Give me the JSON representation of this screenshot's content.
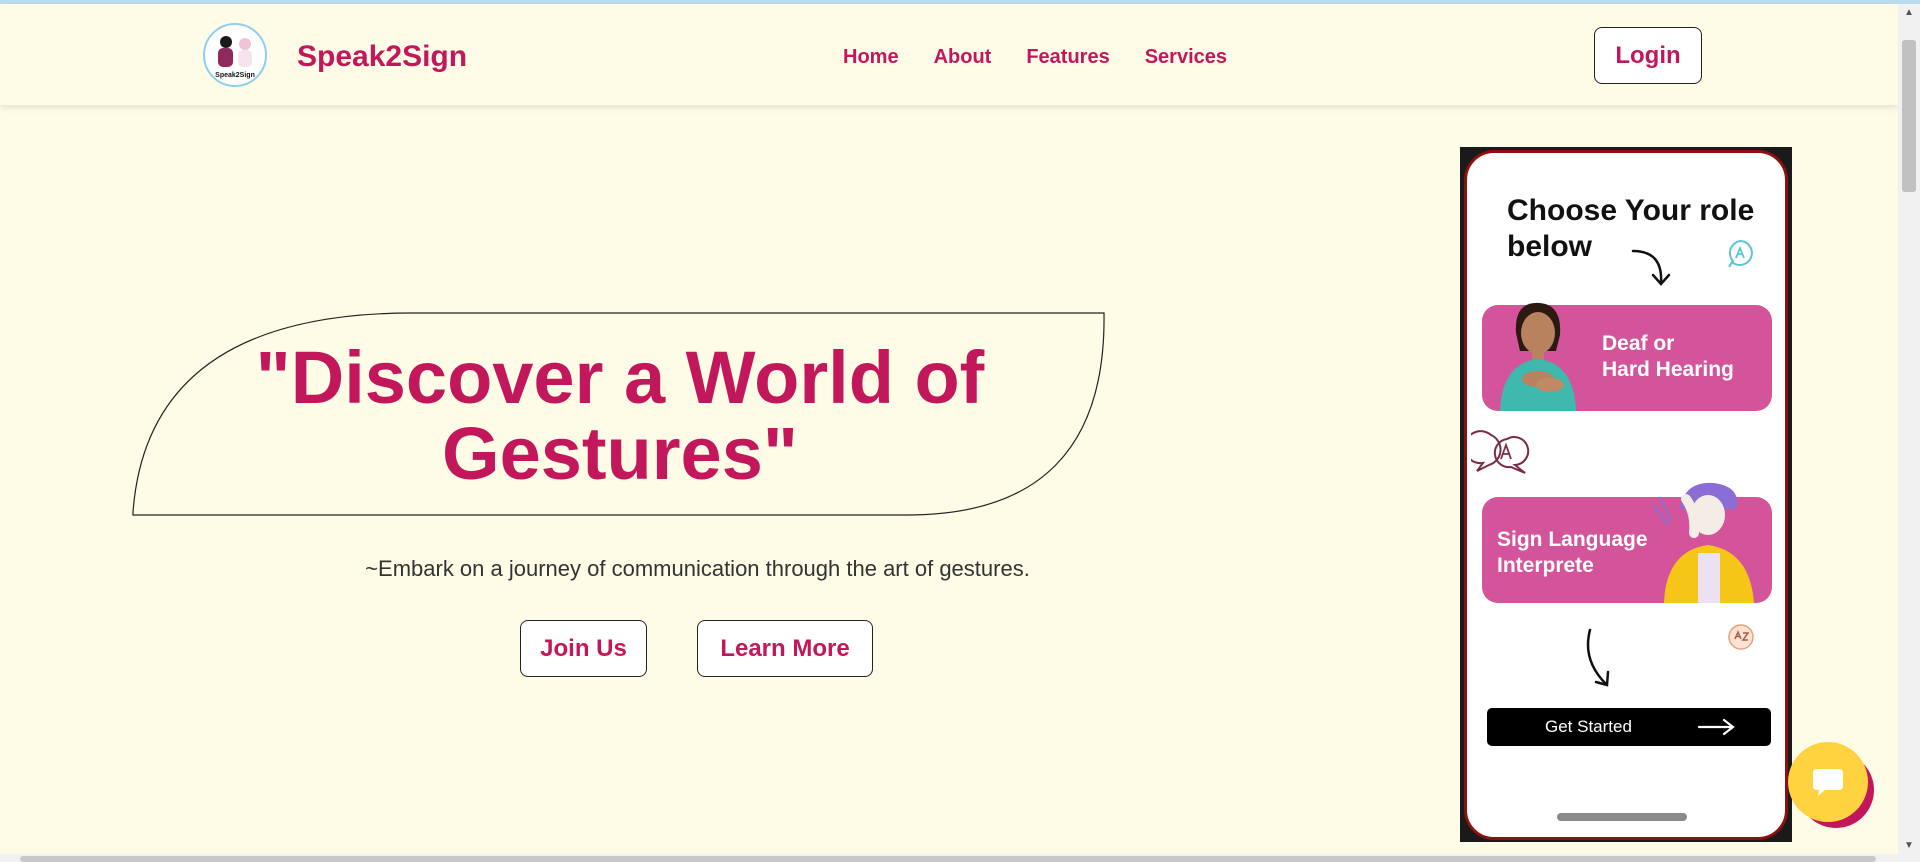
{
  "brand": {
    "name": "Speak2Sign",
    "logo_text": "Speak2Sign"
  },
  "nav": {
    "links": [
      "Home",
      "About",
      "Features",
      "Services"
    ],
    "login_label": "Login"
  },
  "hero": {
    "title_line1": "\"Discover a World of",
    "title_line2": "Gestures\"",
    "tagline": "~Embark on a journey of communication through the art of gestures.",
    "join_label": "Join Us",
    "learn_label": "Learn More"
  },
  "phone": {
    "title_line1": "Choose Your role",
    "title_line2": "below",
    "role_deaf_line1": "Deaf or",
    "role_deaf_line2": "Hard Hearing",
    "role_interp_line1": "Sign Language",
    "role_interp_line2": "Interprete",
    "get_started": "Get Started"
  },
  "colors": {
    "brand": "#c2185b",
    "background": "#fefbe6",
    "card": "#d4549b",
    "chat": "#ffd23f"
  },
  "icons": [
    "speech-sign-icon",
    "arrow-curve-icon",
    "chat-icon",
    "arrow-right-icon"
  ]
}
